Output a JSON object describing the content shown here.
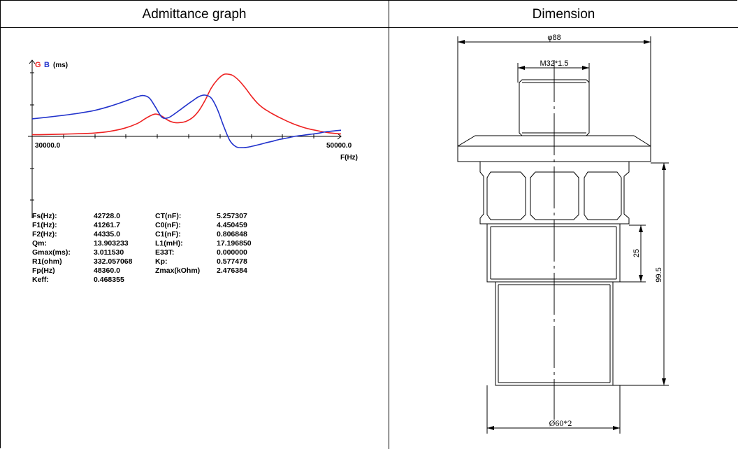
{
  "headers": {
    "left": "Admittance graph",
    "right": "Dimension"
  },
  "colors": {
    "G": "#ee2222",
    "B": "#2233cc",
    "axis": "#000000"
  },
  "chart_data": {
    "type": "line",
    "legend": {
      "G": "G",
      "B": "B",
      "unit": "(ms)"
    },
    "xlabel": "F(Hz)",
    "x_tick_labels": [
      "30000.0",
      "50000.0"
    ],
    "xlim": [
      30000,
      50000
    ],
    "series": [
      {
        "name": "G",
        "x": [
          30000,
          31000,
          32000,
          33000,
          34000,
          35000,
          36000,
          36800,
          37200,
          37600,
          38000,
          38400,
          38800,
          39200,
          39600,
          40000,
          40400,
          40800,
          41200,
          41600,
          42000,
          42400,
          42728,
          43000,
          43400,
          43800,
          44200,
          44600,
          45000,
          45500,
          46000,
          46500,
          47000,
          47500,
          48000,
          48500,
          49000,
          49500,
          50000
        ],
        "y": [
          0.08,
          0.09,
          0.11,
          0.13,
          0.16,
          0.24,
          0.4,
          0.62,
          0.8,
          0.98,
          1.08,
          0.98,
          0.78,
          0.67,
          0.67,
          0.74,
          0.92,
          1.25,
          1.75,
          2.35,
          2.75,
          3.0,
          3.01,
          2.95,
          2.7,
          2.35,
          1.95,
          1.6,
          1.35,
          1.12,
          0.92,
          0.74,
          0.58,
          0.45,
          0.35,
          0.27,
          0.2,
          0.15,
          0.12
        ]
      },
      {
        "name": "B",
        "x": [
          30000,
          31000,
          32000,
          33000,
          34000,
          35000,
          36000,
          36800,
          37200,
          37600,
          38000,
          38400,
          38800,
          39200,
          39600,
          40000,
          40400,
          40800,
          41200,
          41600,
          42000,
          42400,
          42800,
          43200,
          43600,
          44000,
          44400,
          44800,
          45200,
          45600,
          46000,
          46500,
          47000,
          47500,
          48000,
          48500,
          49000,
          49500,
          50000
        ],
        "y": [
          0.85,
          0.93,
          1.02,
          1.12,
          1.25,
          1.45,
          1.7,
          1.92,
          1.98,
          1.85,
          1.4,
          0.93,
          0.9,
          1.08,
          1.3,
          1.52,
          1.73,
          1.93,
          2.0,
          1.85,
          1.3,
          0.5,
          -0.2,
          -0.5,
          -0.55,
          -0.52,
          -0.45,
          -0.38,
          -0.3,
          -0.23,
          -0.15,
          -0.08,
          0.0,
          0.05,
          0.1,
          0.15,
          0.22,
          0.26,
          0.3
        ]
      }
    ]
  },
  "params": [
    [
      {
        "label": "Fs(Hz):",
        "value": "42728.0"
      },
      {
        "label": "F1(Hz):",
        "value": "41261.7"
      },
      {
        "label": "F2(Hz):",
        "value": "44335.0"
      },
      {
        "label": "Qm:",
        "value": "13.903233"
      },
      {
        "label": "Gmax(ms):",
        "value": "3.011530"
      },
      {
        "label": "R1(ohm)",
        "value": "332.057068"
      },
      {
        "label": "Fp(Hz)",
        "value": "48360.0"
      },
      {
        "label": "Keff:",
        "value": "0.468355"
      }
    ],
    [
      {
        "label": "CT(nF):",
        "value": "5.257307"
      },
      {
        "label": "C0(nF):",
        "value": "4.450459"
      },
      {
        "label": "C1(nF):",
        "value": "0.806848"
      },
      {
        "label": "L1(mH):",
        "value": "17.196850"
      },
      {
        "label": "E33T:",
        "value": "0.000000"
      },
      {
        "label": "Kp:",
        "value": "0.577478"
      },
      {
        "label": "Zmax(kOhm)",
        "value": "2.476384"
      }
    ]
  ],
  "dimensions": {
    "top_width": "φ88",
    "thread": "M32*1.5",
    "height_25": "25",
    "height_total": "99.5",
    "bottom_width": "Ø60*2"
  }
}
